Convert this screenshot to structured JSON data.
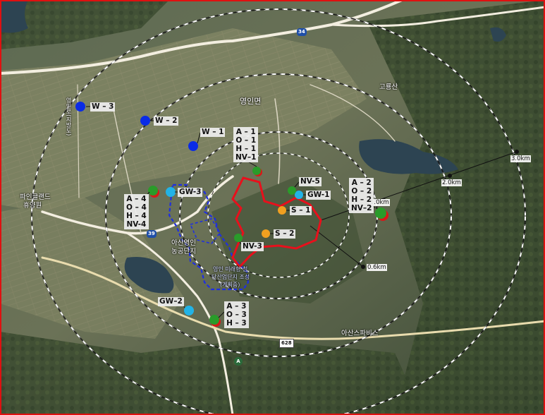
{
  "colors": {
    "border": "#e01010",
    "project_boundary": "#e8101c",
    "industrial_complex_boundary": "#1f2fe0",
    "buffer_rings": "#ffffff",
    "groundwater_well": "#22b3e6",
    "surface_water": "#0a2be6",
    "air_noise_point": "#2a9b2a",
    "soil_point": "#f0a020",
    "river": "#2a4a5c"
  },
  "buffers": [
    {
      "label": "0.6km"
    },
    {
      "label": "1.0km"
    },
    {
      "label": "2.0km"
    },
    {
      "label": "3.0km"
    }
  ],
  "stations": {
    "w1": "W – 1",
    "w2": "W – 2",
    "w3": "W – 3",
    "gw1": "GW-1",
    "gw2": "GW–2",
    "gw3": "GW-3",
    "nv5": "NV-5",
    "nv3": "NV-3",
    "s1": "S – 1",
    "s2": "S – 2"
  },
  "station_groups": {
    "g1": [
      "A – 1",
      "O – 1",
      "H – 1",
      "NV–1"
    ],
    "g2": [
      "A – 2",
      "O – 2",
      "H – 2",
      "NV–2"
    ],
    "g3": [
      "A – 3",
      "O – 3",
      "H – 3"
    ],
    "g4": [
      "A – 4",
      "O – 4",
      "H – 4",
      "NV-4"
    ]
  },
  "places": {
    "yeongin": "영인면",
    "gorongsan": "고룡산",
    "pine_land": "파인클랜드",
    "pine_land2": "휴양원",
    "asan_complex": "아산영인",
    "asan_complex2": "농공단지",
    "complex_plan": "영인 미래형 첨",
    "complex_plan2": "단산업단지 조성",
    "complex_plan3": "(계획중)",
    "asan_spa": "아산스파비스",
    "vertical_road": "영인로(지방도)"
  },
  "roads": {
    "r34": "34",
    "r39": "39",
    "r628": "628",
    "r_loc": "A"
  }
}
